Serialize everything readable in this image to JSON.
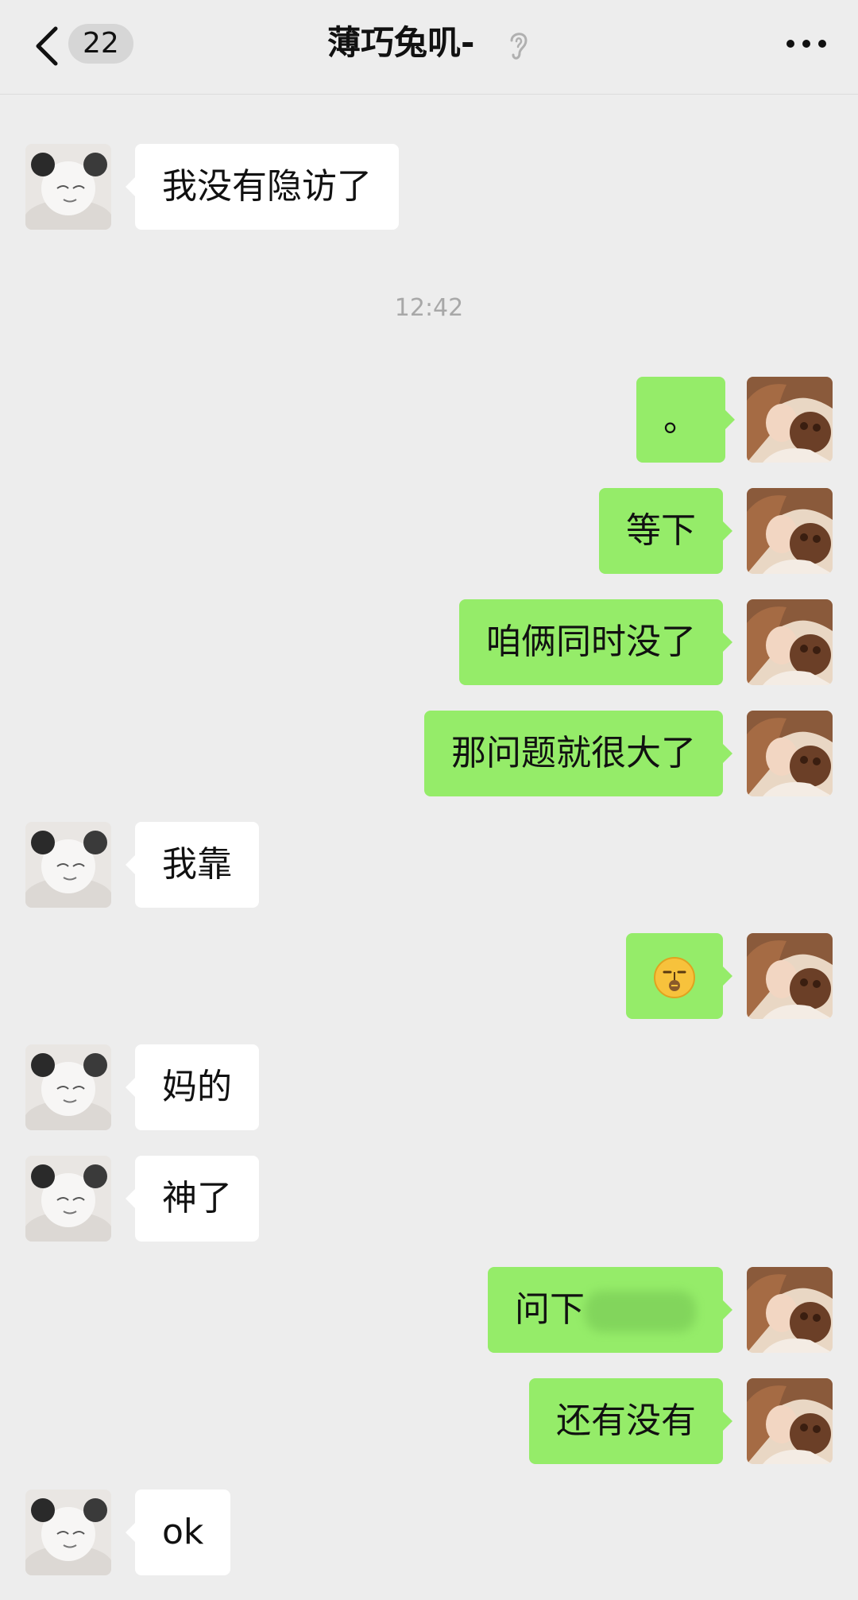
{
  "header": {
    "back_icon": "chevron-left-icon",
    "unread_count": "22",
    "title": "薄巧兔叽-",
    "muted_icon": "ear-icon",
    "more_icon": "more-dots-icon"
  },
  "colors": {
    "background": "#ededed",
    "incoming_bubble": "#ffffff",
    "outgoing_bubble": "#95ec69",
    "timestamp_text": "#a8a8a8"
  },
  "timestamp": "12:42",
  "messages": [
    {
      "side": "left",
      "text": "我没有隐访了"
    },
    {
      "side": "right",
      "text": "。"
    },
    {
      "side": "right",
      "text": "等下"
    },
    {
      "side": "right",
      "text": "咱俩同时没了"
    },
    {
      "side": "right",
      "text": "那问题就很大了"
    },
    {
      "side": "left",
      "text": "我靠"
    },
    {
      "side": "right",
      "text": "",
      "emoji": "zipped-mouth-face-emoji"
    },
    {
      "side": "left",
      "text": "妈的"
    },
    {
      "side": "left",
      "text": "神了"
    },
    {
      "side": "right",
      "text": "问下",
      "redacted": true
    },
    {
      "side": "right",
      "text": "还有没有"
    },
    {
      "side": "left",
      "text": "ok"
    }
  ]
}
